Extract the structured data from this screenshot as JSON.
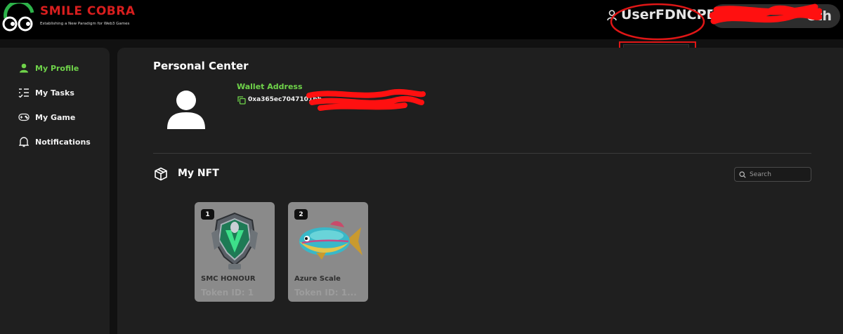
{
  "header": {
    "brand_title": "SMILE COBRA",
    "brand_tagline": "Establishing a New Paradigm for Web3 Games",
    "username": "UserFDNCPE",
    "wallet_suffix": "eth"
  },
  "dropdown": {
    "personal_center": "Personal Center"
  },
  "sidebar": {
    "items": [
      {
        "label": "My Profile",
        "icon": "user-icon",
        "active": true
      },
      {
        "label": "My Tasks",
        "icon": "tasks-icon",
        "active": false
      },
      {
        "label": "My Game",
        "icon": "gamepad-icon",
        "active": false
      },
      {
        "label": "Notifications",
        "icon": "bell-icon",
        "active": false
      }
    ]
  },
  "main": {
    "title": "Personal Center",
    "wallet_label": "Wallet Address",
    "wallet_address": "0xa365ec7047101bb",
    "nft_title": "My NFT",
    "search_placeholder": "Search"
  },
  "nfts": [
    {
      "badge": "1",
      "name": "SMC HONOUR",
      "token": "Token ID: 1"
    },
    {
      "badge": "2",
      "name": "Azure Scale",
      "token": "Token ID: 1..."
    }
  ],
  "colors": {
    "accent_green": "#6fd34a",
    "brand_red": "#d81e1e",
    "annotation_red": "#e01616",
    "panel_bg": "#1f1f1f",
    "page_bg": "#111111"
  }
}
